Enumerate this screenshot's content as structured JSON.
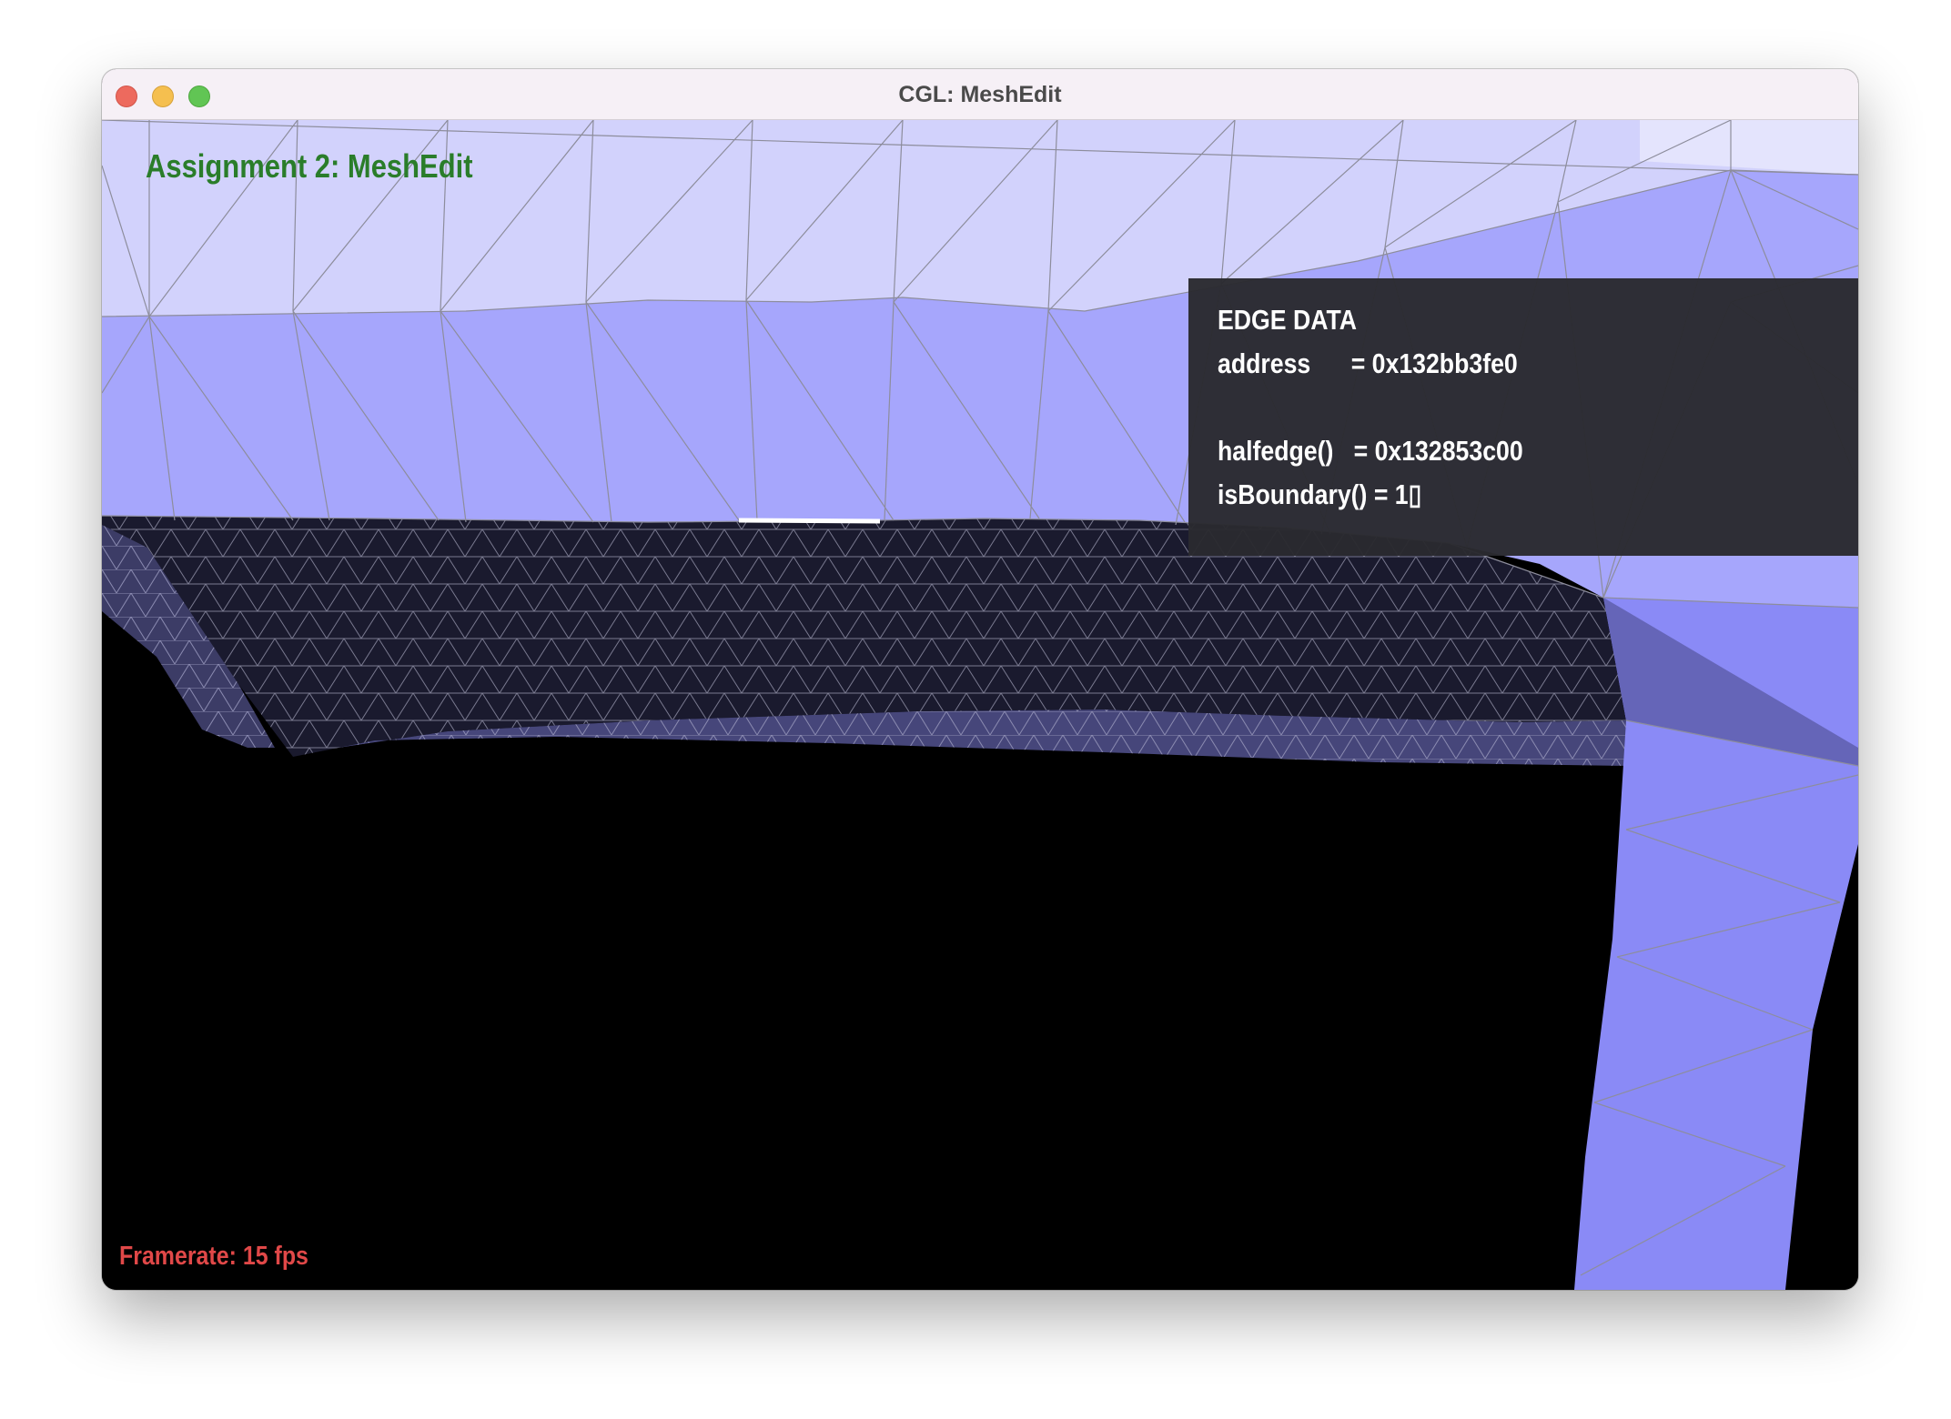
{
  "window": {
    "title": "CGL: MeshEdit"
  },
  "overlay": {
    "assignment_title": "Assignment 2: MeshEdit",
    "framerate": "Framerate: 15 fps"
  },
  "edge_panel": {
    "heading": "EDGE DATA",
    "address_line": "address      = 0x132bb3fe0",
    "halfedge_line": "halfedge()   = 0x132853c00",
    "boundary_line": "isBoundary() = 1▯"
  },
  "colors": {
    "assignment_title": "#2a7d2a",
    "framerate": "#e04848",
    "mesh_light": "#d2d2fc",
    "mesh_mid": "#a6a6fc",
    "mesh_band": "#8c8cf8",
    "mesh_dark": "#1a1a2e",
    "selected_edge": "#ffffff"
  }
}
